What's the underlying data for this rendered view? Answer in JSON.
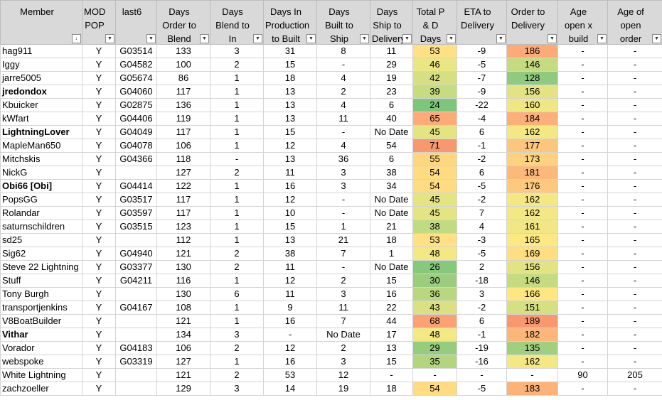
{
  "columns": [
    {
      "key": "member",
      "label": "Member",
      "align": "l",
      "width": 115
    },
    {
      "key": "mod",
      "label": "MOD POP",
      "align": "c",
      "width": 47
    },
    {
      "key": "last6",
      "label": "last6",
      "align": "c",
      "width": 58
    },
    {
      "key": "o2b",
      "label": "Days Order to Blend",
      "align": "c",
      "width": 75
    },
    {
      "key": "b2p",
      "label": "Days Blend to In Production",
      "align": "c",
      "width": 75
    },
    {
      "key": "p2b",
      "label": "Days In Production to Built",
      "align": "c",
      "width": 75
    },
    {
      "key": "b2s",
      "label": "Days Built to Ship",
      "align": "c",
      "width": 75
    },
    {
      "key": "s2d",
      "label": "Days Ship to Delivery",
      "align": "c",
      "width": 60
    },
    {
      "key": "tpd",
      "label": "Total P & D Days",
      "align": "c",
      "width": 62
    },
    {
      "key": "eta",
      "label": "ETA to Delivery",
      "align": "c",
      "width": 70
    },
    {
      "key": "o2d",
      "label": "Order to Delivery",
      "align": "c",
      "width": 72
    },
    {
      "key": "age",
      "label": "Age open x build week",
      "align": "c",
      "width": 70
    },
    {
      "key": "ageo",
      "label": "Age of open order",
      "align": "c",
      "width": 77
    }
  ],
  "filter_glyph": "▼",
  "sort_filter_glyph": "↓",
  "rows": [
    {
      "member": "hag911",
      "link": false,
      "mod": "Y",
      "last6": "G03514",
      "o2b": "133",
      "b2p": "3",
      "p2b": "31",
      "b2s": "8",
      "s2d": "11",
      "tpd": "53",
      "tpd_color": "#ffe084",
      "eta": "-9",
      "o2d": "186",
      "o2d_color": "#fcaa78",
      "age": "-",
      "ageo": "-"
    },
    {
      "member": "Iggy",
      "link": false,
      "mod": "Y",
      "last6": "G04582",
      "o2b": "100",
      "b2p": "2",
      "p2b": "15",
      "b2s": "-",
      "s2d": "29",
      "tpd": "46",
      "tpd_color": "#eae683",
      "eta": "-5",
      "o2d": "146",
      "o2d_color": "#c6db81",
      "age": "-",
      "ageo": "-"
    },
    {
      "member": "jarre5005",
      "link": false,
      "mod": "Y",
      "last6": "G05674",
      "o2b": "86",
      "b2p": "1",
      "p2b": "18",
      "b2s": "4",
      "s2d": "19",
      "tpd": "42",
      "tpd_color": "#d6e082",
      "eta": "-7",
      "o2d": "128",
      "o2d_color": "#8fca7e",
      "age": "-",
      "ageo": "-"
    },
    {
      "member": "jredondox",
      "link": true,
      "mod": "Y",
      "last6": "G04060",
      "o2b": "117",
      "b2p": "1",
      "p2b": "13",
      "b2s": "2",
      "s2d": "23",
      "tpd": "39",
      "tpd_color": "#c7dc81",
      "eta": "-9",
      "o2d": "156",
      "o2d_color": "#e3e383",
      "age": "-",
      "ageo": "-"
    },
    {
      "member": "Kbuicker",
      "link": false,
      "mod": "Y",
      "last6": "G02875",
      "o2b": "136",
      "b2p": "1",
      "p2b": "13",
      "b2s": "4",
      "s2d": "6",
      "tpd": "24",
      "tpd_color": "#7fc67d",
      "eta": "-22",
      "o2d": "160",
      "o2d_color": "#efe784",
      "age": "-",
      "ageo": "-"
    },
    {
      "member": "kWfart",
      "link": false,
      "mod": "Y",
      "last6": "G04406",
      "o2b": "119",
      "b2p": "1",
      "p2b": "13",
      "b2s": "11",
      "s2d": "40",
      "tpd": "65",
      "tpd_color": "#fcaa78",
      "eta": "-4",
      "o2d": "184",
      "o2d_color": "#fcb079",
      "age": "-",
      "ageo": "-"
    },
    {
      "member": "LightningLover",
      "link": true,
      "mod": "Y",
      "last6": "G04049",
      "o2b": "117",
      "b2p": "1",
      "p2b": "15",
      "b2s": "-",
      "s2d": "No Date",
      "tpd": "45",
      "tpd_color": "#e5e483",
      "eta": "6",
      "o2d": "162",
      "o2d_color": "#f4e884",
      "age": "-",
      "ageo": "-"
    },
    {
      "member": "MapleMan650",
      "link": false,
      "mod": "Y",
      "last6": "G04078",
      "o2b": "106",
      "b2p": "1",
      "p2b": "12",
      "b2s": "4",
      "s2d": "54",
      "tpd": "71",
      "tpd_color": "#f8986f",
      "eta": "-1",
      "o2d": "177",
      "o2d_color": "#fdc67d",
      "age": "-",
      "ageo": "-"
    },
    {
      "member": "Mitchskis",
      "link": false,
      "mod": "Y",
      "last6": "G04366",
      "o2b": "118",
      "b2p": "-",
      "p2b": "13",
      "b2s": "36",
      "s2d": "6",
      "tpd": "55",
      "tpd_color": "#fed680",
      "eta": "-2",
      "o2d": "173",
      "o2d_color": "#fed27f",
      "age": "-",
      "ageo": "-"
    },
    {
      "member": "NickG",
      "link": false,
      "mod": "Y",
      "last6": "",
      "o2b": "127",
      "b2p": "2",
      "p2b": "11",
      "b2s": "3",
      "s2d": "38",
      "tpd": "54",
      "tpd_color": "#ffdb82",
      "eta": "6",
      "o2d": "181",
      "o2d_color": "#fcb97a",
      "age": "-",
      "ageo": "-"
    },
    {
      "member": "Obi66 [Obi]",
      "link": true,
      "mod": "Y",
      "last6": "G04414",
      "o2b": "122",
      "b2p": "1",
      "p2b": "16",
      "b2s": "3",
      "s2d": "34",
      "tpd": "54",
      "tpd_color": "#ffdb82",
      "eta": "-5",
      "o2d": "176",
      "o2d_color": "#fdc97e",
      "age": "-",
      "ageo": "-"
    },
    {
      "member": "PopsGG",
      "link": false,
      "mod": "Y",
      "last6": "G03517",
      "o2b": "117",
      "b2p": "1",
      "p2b": "12",
      "b2s": "-",
      "s2d": "No Date",
      "tpd": "45",
      "tpd_color": "#e5e483",
      "eta": "-2",
      "o2d": "162",
      "o2d_color": "#f4e884",
      "age": "-",
      "ageo": "-"
    },
    {
      "member": "Rolandar",
      "link": false,
      "mod": "Y",
      "last6": "G03597",
      "o2b": "117",
      "b2p": "1",
      "p2b": "10",
      "b2s": "-",
      "s2d": "No Date",
      "tpd": "45",
      "tpd_color": "#e5e483",
      "eta": "7",
      "o2d": "162",
      "o2d_color": "#f4e884",
      "age": "-",
      "ageo": "-"
    },
    {
      "member": "saturnschildren",
      "link": false,
      "mod": "Y",
      "last6": "G03515",
      "o2b": "123",
      "b2p": "1",
      "p2b": "15",
      "b2s": "1",
      "s2d": "21",
      "tpd": "38",
      "tpd_color": "#c2da80",
      "eta": "4",
      "o2d": "161",
      "o2d_color": "#f1e784",
      "age": "-",
      "ageo": "-"
    },
    {
      "member": "sd25",
      "link": false,
      "mod": "Y",
      "last6": "",
      "o2b": "112",
      "b2p": "1",
      "p2b": "13",
      "b2s": "21",
      "s2d": "18",
      "tpd": "53",
      "tpd_color": "#ffe084",
      "eta": "-3",
      "o2d": "165",
      "o2d_color": "#fde983",
      "age": "-",
      "ageo": "-"
    },
    {
      "member": "Sig62",
      "link": false,
      "mod": "Y",
      "last6": "G04940",
      "o2b": "121",
      "b2p": "2",
      "p2b": "38",
      "b2s": "7",
      "s2d": "1",
      "tpd": "48",
      "tpd_color": "#f4e884",
      "eta": "-5",
      "o2d": "169",
      "o2d_color": "#fede81",
      "age": "-",
      "ageo": "-"
    },
    {
      "member": "Steve 22 Lightning",
      "link": false,
      "mod": "Y",
      "last6": "G03377",
      "o2b": "130",
      "b2p": "2",
      "p2b": "11",
      "b2s": "-",
      "s2d": "No Date",
      "tpd": "26",
      "tpd_color": "#88c87d",
      "eta": "2",
      "o2d": "156",
      "o2d_color": "#e3e383",
      "age": "-",
      "ageo": "-"
    },
    {
      "member": "Stuff",
      "link": false,
      "mod": "Y",
      "last6": "G04211",
      "o2b": "116",
      "b2p": "1",
      "p2b": "12",
      "b2s": "2",
      "s2d": "15",
      "tpd": "30",
      "tpd_color": "#9ccd7e",
      "eta": "-18",
      "o2d": "146",
      "o2d_color": "#c6db81",
      "age": "-",
      "ageo": "-"
    },
    {
      "member": "Tony Burgh",
      "link": false,
      "mod": "Y",
      "last6": "",
      "o2b": "130",
      "b2p": "6",
      "p2b": "11",
      "b2s": "3",
      "s2d": "16",
      "tpd": "36",
      "tpd_color": "#b8d780",
      "eta": "3",
      "o2d": "166",
      "o2d_color": "#fee682",
      "age": "-",
      "ageo": "-"
    },
    {
      "member": "transportjenkins",
      "link": false,
      "mod": "Y",
      "last6": "G04167",
      "o2b": "108",
      "b2p": "1",
      "p2b": "9",
      "b2s": "11",
      "s2d": "22",
      "tpd": "43",
      "tpd_color": "#dbe182",
      "eta": "-2",
      "o2d": "151",
      "o2d_color": "#d5e082",
      "age": "-",
      "ageo": "-"
    },
    {
      "member": "V8BoatBuilder",
      "link": false,
      "mod": "Y",
      "last6": "",
      "o2b": "121",
      "b2p": "1",
      "p2b": "16",
      "b2s": "7",
      "s2d": "44",
      "tpd": "68",
      "tpd_color": "#fba174",
      "eta": "6",
      "o2d": "189",
      "o2d_color": "#f8986f",
      "age": "-",
      "ageo": "-"
    },
    {
      "member": "Vithar",
      "link": true,
      "mod": "Y",
      "last6": "",
      "o2b": "134",
      "b2p": "3",
      "p2b": "-",
      "b2s": "No Date",
      "s2d": "17",
      "tpd": "48",
      "tpd_color": "#f4e884",
      "eta": "-1",
      "o2d": "182",
      "o2d_color": "#fcb67a",
      "age": "-",
      "ageo": "-"
    },
    {
      "member": "Vorador",
      "link": false,
      "mod": "Y",
      "last6": "G04183",
      "o2b": "106",
      "b2p": "2",
      "p2b": "12",
      "b2s": "2",
      "s2d": "13",
      "tpd": "29",
      "tpd_color": "#97cb7e",
      "eta": "-19",
      "o2d": "135",
      "o2d_color": "#a2cf7f",
      "age": "-",
      "ageo": "-"
    },
    {
      "member": "webspoke",
      "link": false,
      "mod": "Y",
      "last6": "G03319",
      "o2b": "127",
      "b2p": "1",
      "p2b": "16",
      "b2s": "3",
      "s2d": "15",
      "tpd": "35",
      "tpd_color": "#b3d580",
      "eta": "-16",
      "o2d": "162",
      "o2d_color": "#f4e884",
      "age": "-",
      "ageo": "-"
    },
    {
      "member": "White Lightning",
      "link": false,
      "mod": "Y",
      "last6": "",
      "o2b": "121",
      "b2p": "2",
      "p2b": "53",
      "b2s": "12",
      "s2d": "-",
      "tpd": "-",
      "tpd_color": "",
      "eta": "-",
      "o2d": "-",
      "o2d_color": "",
      "age": "90",
      "ageo": "205"
    },
    {
      "member": "zachzoeller",
      "link": false,
      "mod": "Y",
      "last6": "",
      "o2b": "129",
      "b2p": "3",
      "p2b": "14",
      "b2s": "19",
      "s2d": "18",
      "tpd": "54",
      "tpd_color": "#ffdb82",
      "eta": "-5",
      "o2d": "183",
      "o2d_color": "#fcb379",
      "age": "-",
      "ageo": "-"
    }
  ]
}
